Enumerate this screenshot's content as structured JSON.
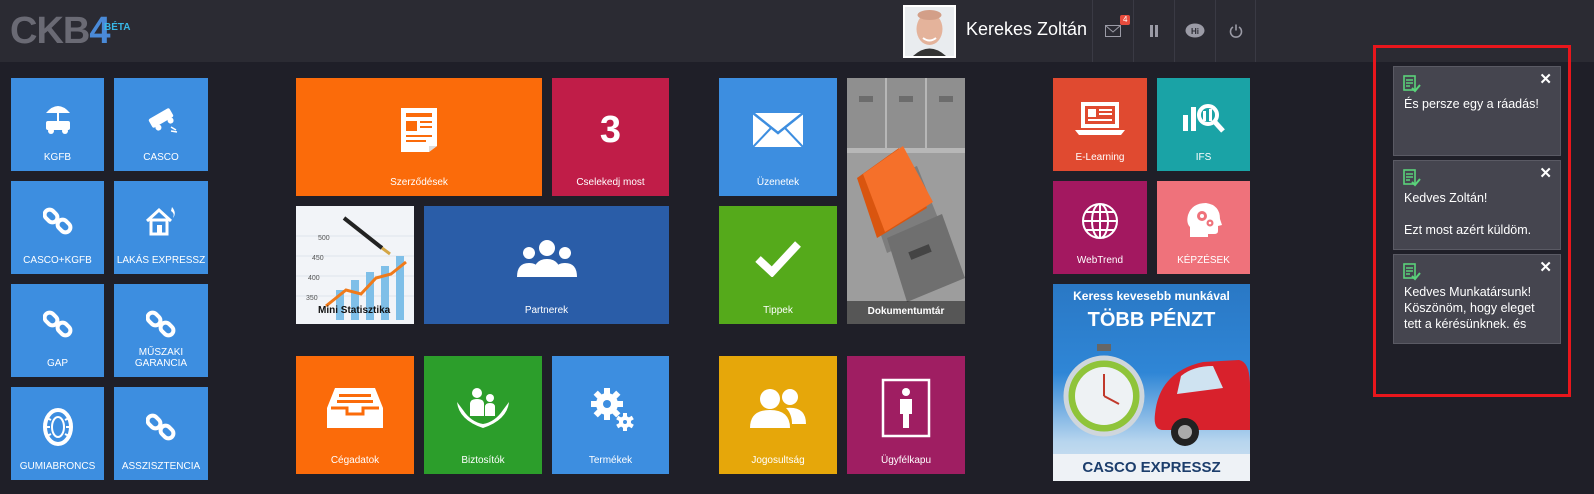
{
  "header": {
    "logo_text": "CKB",
    "logo_number": "4",
    "logo_badge": "BÉTA",
    "user_name": "Kerekes Zoltán",
    "message_count": "4",
    "icons": [
      "mail-icon",
      "pause-icon",
      "chat-hi-icon",
      "power-icon"
    ]
  },
  "tiles": {
    "kgfb": "KGFB",
    "casco": "CASCO",
    "casco_kgfb": "CASCO+KGFB",
    "lakas": "LAKÁS EXPRESSZ",
    "gap": "GAP",
    "muszaki": "MŰSZAKI GARANCIA",
    "gumiabroncs": "GUMIABRONCS",
    "asszisztencia": "ASSZISZTENCIA",
    "szerzodesek": "Szerződések",
    "cselekedj_count": "3",
    "cselekedj": "Cselekedj most",
    "mini_stat": "Mini Statisztika",
    "partnerek": "Partnerek",
    "uzenetek": "Üzenetek",
    "tippek": "Tippek",
    "dokumentumtar": "Dokumentumtár",
    "cegadatok": "Cégadatok",
    "biztositok": "Biztosítók",
    "termekek": "Termékek",
    "jogosultsag": "Jogosultság",
    "ugyfelkapu": "Ügyfélkapu",
    "elearning": "E-Learning",
    "ifs": "IFS",
    "webtrend": "WebTrend",
    "kepzesek": "KÉPZÉSEK"
  },
  "banner": {
    "line1": "Keress kevesebb munkával",
    "line2": "TÖBB PÉNZT",
    "line3": "CASCO EXPRESSZ"
  },
  "notifications": [
    {
      "text": "És persze egy a ráadás!"
    },
    {
      "text": "Kedves Zoltán!\n\nEzt most azért küldöm."
    },
    {
      "text": "Kedves Munkatársunk! Köszönöm, hogy eleget tett a kérésünknek. és"
    }
  ],
  "colors": {
    "accent_blue": "#3d8ee0",
    "highlight_red": "#e8161c",
    "background": "#1f1f28"
  }
}
